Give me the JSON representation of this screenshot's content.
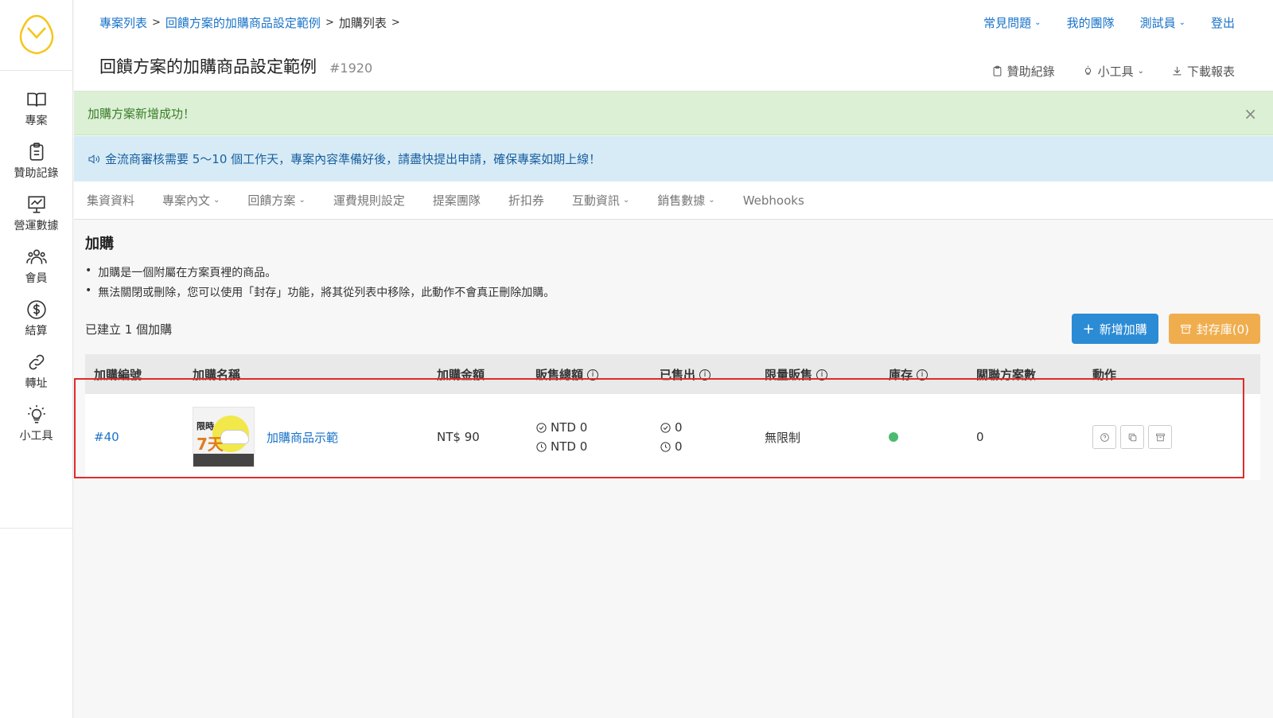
{
  "sidebar": {
    "items": [
      {
        "label": "專案",
        "icon": "book-icon"
      },
      {
        "label": "贊助記錄",
        "icon": "clipboard-icon"
      },
      {
        "label": "營運數據",
        "icon": "chart-icon"
      },
      {
        "label": "會員",
        "icon": "users-icon"
      },
      {
        "label": "結算",
        "icon": "dollar-icon"
      },
      {
        "label": "轉址",
        "icon": "link-icon"
      },
      {
        "label": "小工具",
        "icon": "bulb-icon"
      }
    ]
  },
  "header": {
    "breadcrumb": [
      "專案列表",
      "回饋方案的加購商品設定範例",
      "加購列表"
    ],
    "topnav": {
      "faq": "常見問題",
      "team": "我的團隊",
      "user": "測試員",
      "logout": "登出"
    },
    "title": "回饋方案的加購商品設定範例",
    "project_id": "#1920",
    "tools": {
      "sponsor_log": "贊助紀錄",
      "widgets": "小工具",
      "download": "下載報表"
    }
  },
  "alerts": {
    "success": "加購方案新增成功！",
    "info": "金流商審核需要 5～10 個工作天，專案內容準備好後，請盡快提出申請，確保專案如期上線！"
  },
  "tabs": [
    "集資資料",
    "專案內文",
    "回饋方案",
    "運費規則設定",
    "提案團隊",
    "折扣券",
    "互動資訊",
    "銷售數據",
    "Webhooks"
  ],
  "main": {
    "title": "加購",
    "notes": [
      "加購是一個附屬在方案頁裡的商品。",
      "無法關閉或刪除，您可以使用「封存」功能，將其從列表中移除，此動作不會真正刪除加購。"
    ],
    "count_text": "已建立 1 個加購",
    "add_button": "新增加購",
    "archive_button": "封存庫(0)"
  },
  "table": {
    "headers": [
      "加購編號",
      "加購名稱",
      "加購金額",
      "販售總額",
      "已售出",
      "限量販售",
      "庫存",
      "關聯方案數",
      "動作"
    ],
    "rows": [
      {
        "id": "#40",
        "name": "加購商品示範",
        "price": "NT$ 90",
        "sales_done": "NTD 0",
        "sales_pending": "NTD 0",
        "sold_done": "0",
        "sold_pending": "0",
        "limit": "無限制",
        "stock_color": "#4cbb72",
        "related": "0",
        "thumb_text_1": "限時",
        "thumb_text_2": "7天"
      }
    ]
  }
}
